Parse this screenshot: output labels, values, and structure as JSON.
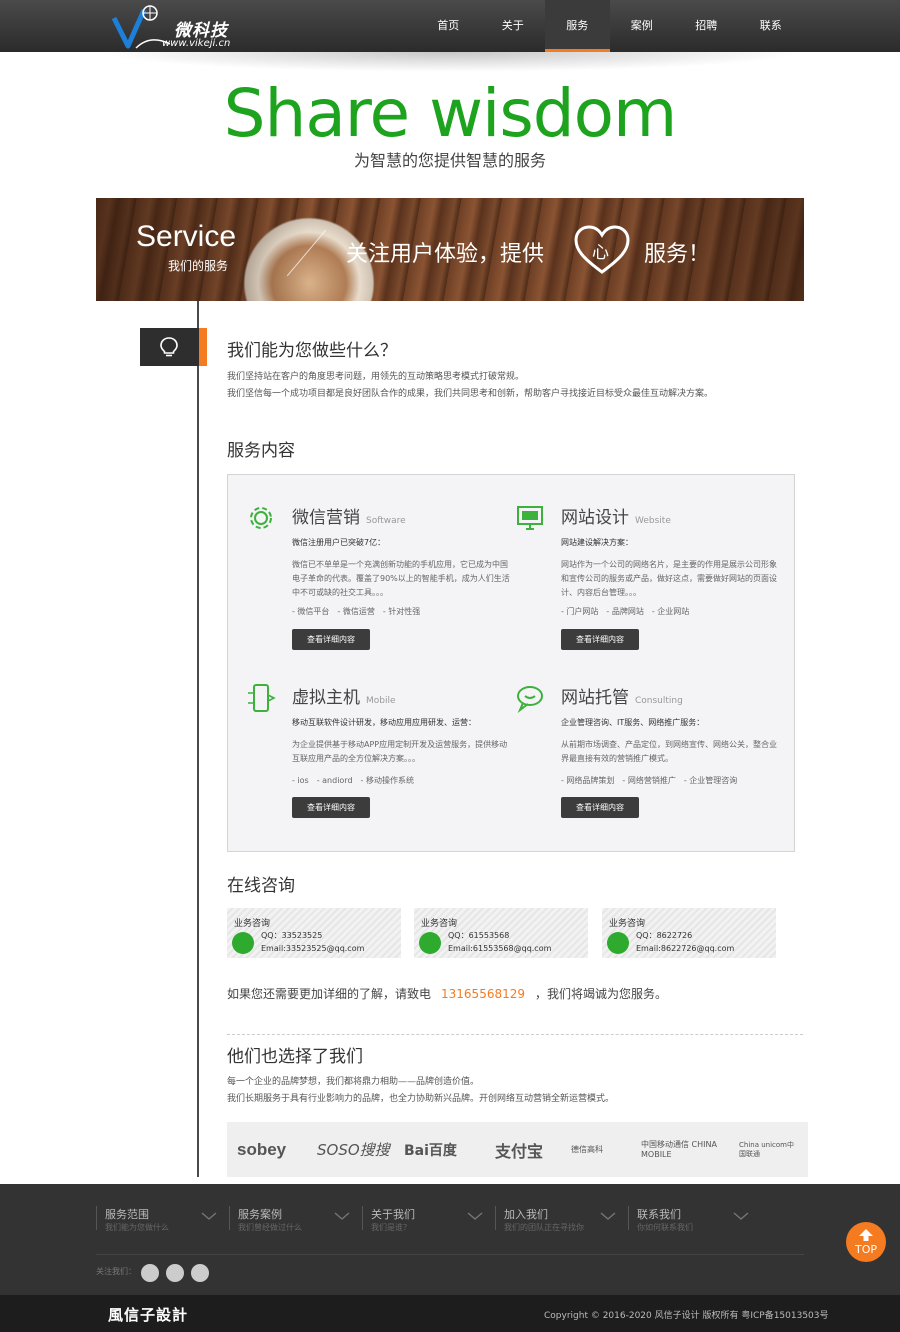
{
  "header": {
    "logo_cn": "微科技",
    "logo_url": "www.vikeji.cn",
    "nav": [
      "首页",
      "关于",
      "服务",
      "案例",
      "招聘",
      "联系"
    ],
    "active_nav": "服务"
  },
  "hero": {
    "title": "Share wisdom",
    "subtitle": "为智慧的您提供智慧的服务"
  },
  "banner": {
    "service": "Service",
    "service_sub": "我们的服务",
    "text1": "关注用户体验，提供",
    "heart_char": "心",
    "text2": "服务！"
  },
  "what": {
    "title": "我们能为您做些什么？",
    "line1": "我们坚持站在客户的角度思考问题，用领先的互动策略思考模式打破常规。",
    "line2": "我们坚信每一个成功项目都是良好团队合作的成果，我们共同思考和创新，帮助客户寻找接近目标受众最佳互动解决方案。"
  },
  "services_heading": "服务内容",
  "services": [
    {
      "title": "微信营销",
      "en": "Software",
      "icon": "gear-icon",
      "lead": "微信注册用户已突破7亿：",
      "desc": "微信已不单单是一个充满创新功能的手机应用，它已成为中国电子革命的代表。覆盖了90%以上的智能手机，成为人们生活中不可或缺的社交工具。。。",
      "tags": "- 微信平台　- 微信运营　- 针对性强",
      "button": "查看详细内容"
    },
    {
      "title": "网站设计",
      "en": "Website",
      "icon": "monitor-icon",
      "lead": "网站建设解决方案：",
      "desc": "网站作为一个公司的网络名片，是主要的作用是展示公司形象和宣传公司的服务或产品，做好这点，需要做好网站的页面设计、内容后台管理。。。",
      "tags": "- 门户网站　- 品牌网站　- 企业网站",
      "button": "查看详细内容"
    },
    {
      "title": "虚拟主机",
      "en": "Mobile",
      "icon": "mobile-icon",
      "lead": "移动互联软件设计研发，移动应用应用研发、运营：",
      "desc": "为企业提供基于移动APP应用定制开发及运营服务，提供移动互联应用产品的全方位解决方案。。。",
      "tags": "- ios　- andiord　- 移动操作系统",
      "button": "查看详细内容"
    },
    {
      "title": "网站托管",
      "en": "Consulting",
      "icon": "chat-bubble-icon",
      "lead": "企业管理咨询、IT服务、网络推广服务：",
      "desc": "从前期市场调查、产品定位，到网络宣传、网络公关，整合业界最直接有效的营销推广模式。",
      "tags": "- 网络品牌策划　- 网络营销推广　- 企业管理咨询",
      "button": "查看详细内容"
    }
  ],
  "consult_heading": "在线咨询",
  "consults": [
    {
      "title": "业务咨询",
      "qq": "QQ：33523525",
      "email": "Email:33523525@qq.com"
    },
    {
      "title": "业务咨询",
      "qq": "QQ：61553568",
      "email": "Email:61553568@qq.com"
    },
    {
      "title": "业务咨询",
      "qq": "QQ：8622726",
      "email": "Email:8622726@qq.com"
    }
  ],
  "call": {
    "before": "如果您还需要更加详细的了解，请致电",
    "phone": "13165568129",
    "after": "，我们将竭诚为您服务。"
  },
  "clients": {
    "title": "他们也选择了我们",
    "line1": "每一个企业的品牌梦想，我们都将鼎力相助——品牌创造价值。",
    "line2": "我们长期服务于具有行业影响力的品牌，也全力协助新兴品牌。开创网络互动营销全新运营模式。",
    "logos": [
      "sobey",
      "SOSO搜搜",
      "Bai百度",
      "支付宝",
      "德信高科",
      "中国移动通信 CHINA MOBILE",
      "China unicom中国联通"
    ]
  },
  "footer": {
    "columns": [
      {
        "title": "服务范围",
        "sub": "我们能为您做什么"
      },
      {
        "title": "服务案例",
        "sub": "我们曾经做过什么"
      },
      {
        "title": "关于我们",
        "sub": "我们是谁？"
      },
      {
        "title": "加入我们",
        "sub": "我们的团队正在寻找你"
      },
      {
        "title": "联系我们",
        "sub": "你如何联系我们"
      }
    ],
    "follow": "关注我们：",
    "top_label": "TOP",
    "brand": "風信子設計",
    "copyright": "Copyright © 2016-2020 风信子设计 版权所有 粤ICP备15013503号"
  },
  "colors": {
    "accent_orange": "#f47b20",
    "hero_green": "#1da31d",
    "icon_green": "#3cb13c",
    "dark": "#333333"
  }
}
